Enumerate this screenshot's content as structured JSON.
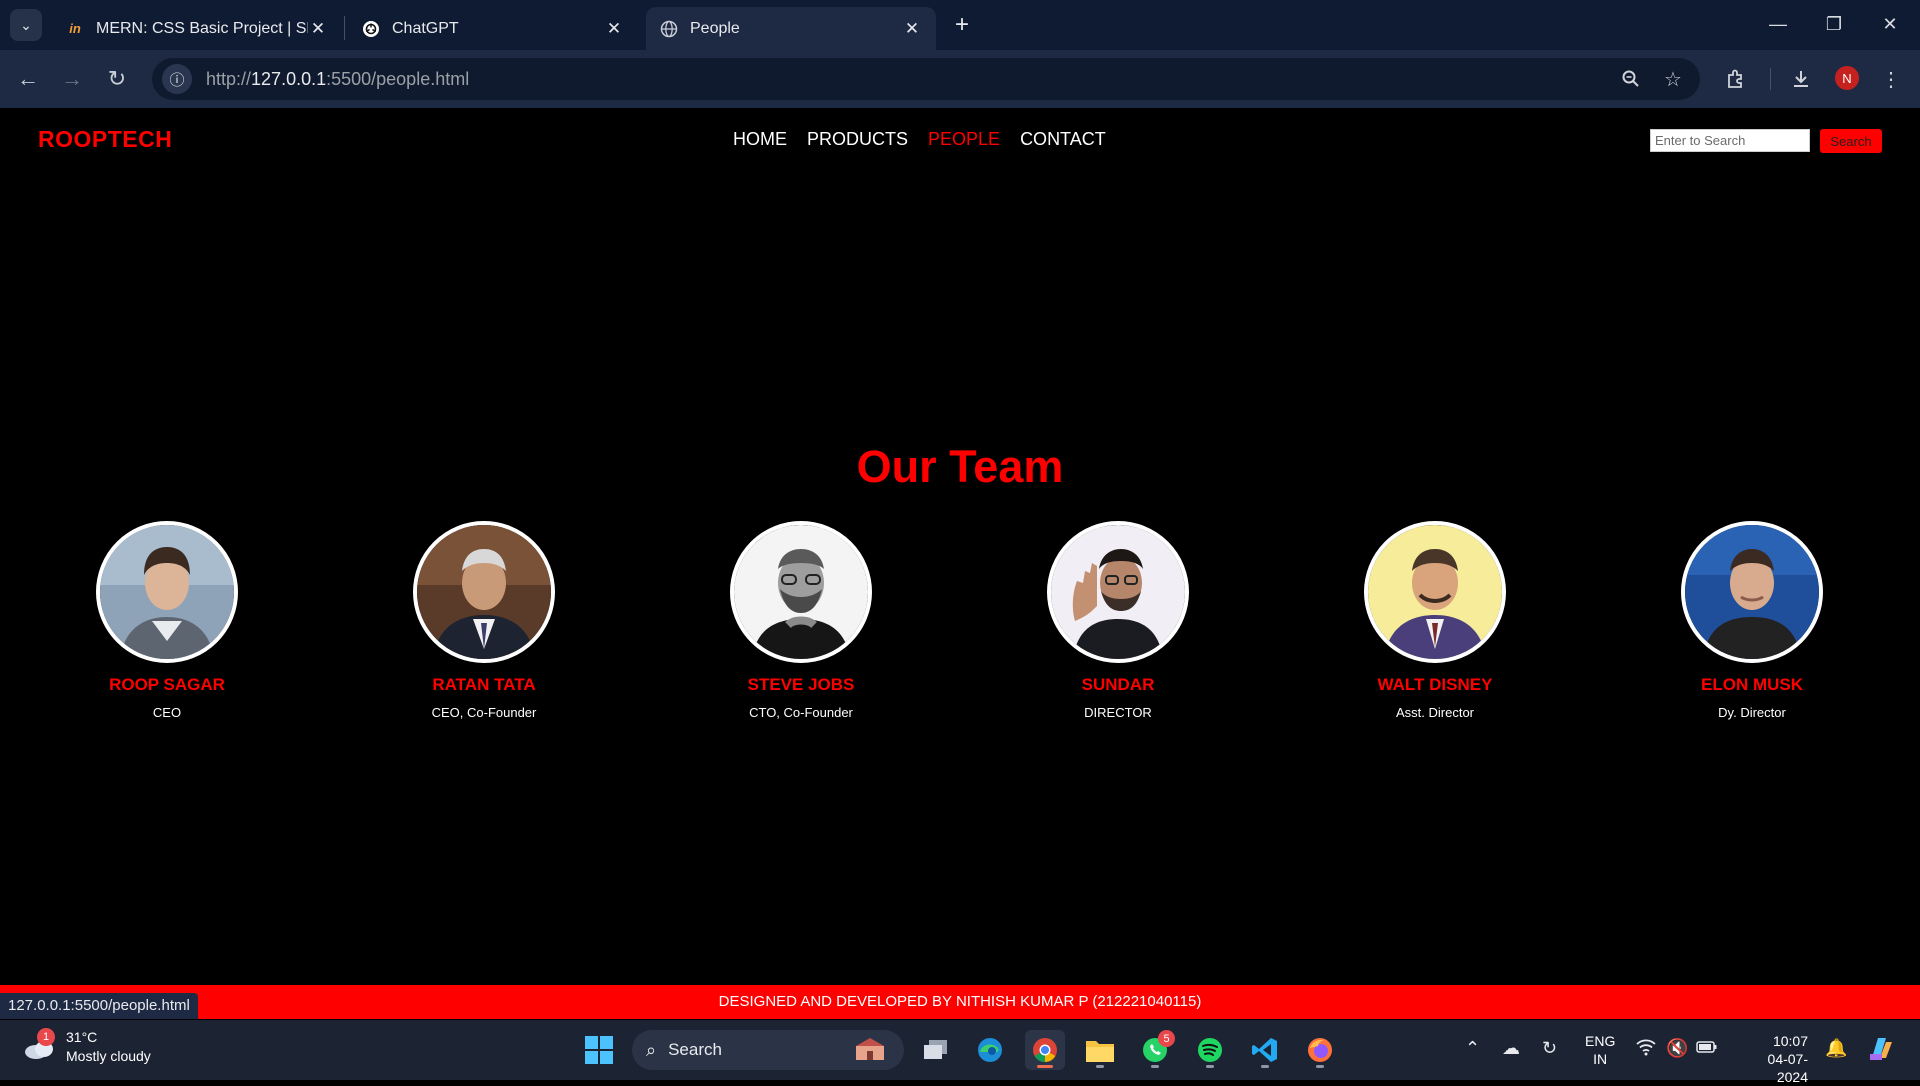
{
  "browser": {
    "tabs": [
      {
        "title": "MERN: CSS Basic Project | SEC",
        "favicon": "in"
      },
      {
        "title": "ChatGPT",
        "favicon": "chatgpt-icon"
      },
      {
        "title": "People",
        "favicon": "globe-icon"
      }
    ],
    "url_scheme": "http://",
    "url_host": "127.0.0.1",
    "url_rest": ":5500/people.html",
    "status_url": "127.0.0.1:5500/people.html",
    "profile_initial": "N"
  },
  "site": {
    "logo": "ROOPTECH",
    "nav": [
      "HOME",
      "PRODUCTS",
      "PEOPLE",
      "CONTACT"
    ],
    "active_nav": "PEOPLE",
    "search_placeholder": "Enter to Search",
    "search_button": "Search",
    "team_title": "Our Team",
    "members": [
      {
        "name": "ROOP SAGAR",
        "role": "CEO"
      },
      {
        "name": "RATAN TATA",
        "role": "CEO, Co-Founder"
      },
      {
        "name": "STEVE JOBS",
        "role": "CTO, Co-Founder"
      },
      {
        "name": "SUNDAR",
        "role": "DIRECTOR"
      },
      {
        "name": "WALT DISNEY",
        "role": "Asst. Director"
      },
      {
        "name": "ELON MUSK",
        "role": "Dy. Director"
      }
    ],
    "footer": "DESIGNED AND DEVELOPED BY NITHISH KUMAR P (212221040115)"
  },
  "taskbar": {
    "weather_temp": "31°C",
    "weather_desc": "Mostly cloudy",
    "weather_badge": "1",
    "search_label": "Search",
    "whatsapp_badge": "5",
    "lang_1": "ENG",
    "lang_2": "IN",
    "time": "10:07",
    "date": "04-07-2024"
  },
  "colors": {
    "accent": "#ff0000",
    "page_bg": "#000000",
    "chrome_bg": "#0f1b33"
  }
}
